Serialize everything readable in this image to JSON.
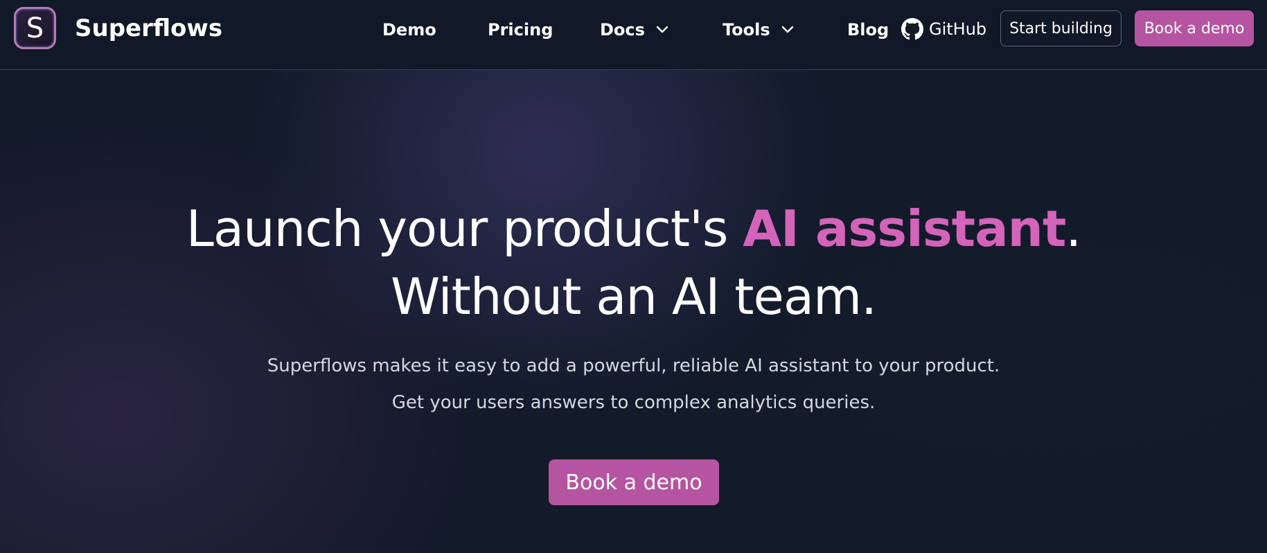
{
  "brand": {
    "logo_letter": "S",
    "name": "Superflows"
  },
  "nav": {
    "items": [
      {
        "label": "Demo"
      },
      {
        "label": "Pricing"
      },
      {
        "label": "Docs",
        "icon": "chevron-down-icon"
      },
      {
        "label": "Tools",
        "icon": "chevron-down-icon"
      },
      {
        "label": "Blog"
      }
    ],
    "github": {
      "label": "GitHub",
      "icon": "github-icon"
    },
    "start_building": "Start building",
    "book_demo": "Book a demo"
  },
  "hero": {
    "headline_part1": "Launch your product's ",
    "headline_accent": "AI assistant",
    "headline_part2": ".",
    "headline_line2": "Without an AI team.",
    "subtitle_line1": "Superflows makes it easy to add a powerful, reliable AI assistant to your product.",
    "subtitle_line2": "Get your users answers to complex analytics queries.",
    "cta": "Book a demo"
  },
  "colors": {
    "accent": "#d364b9",
    "button": "#b555a1",
    "navbar_bg": "#111827",
    "page_bg": "#131a2a"
  }
}
